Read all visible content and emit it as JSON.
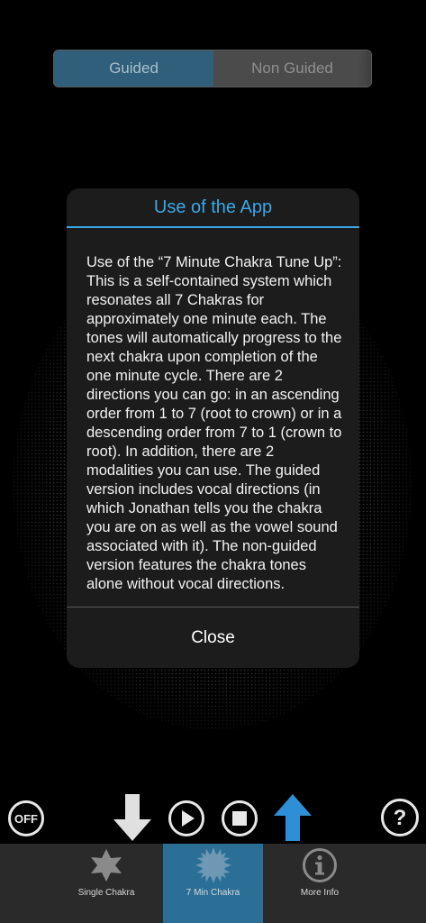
{
  "segmented": {
    "guided_label": "Guided",
    "non_guided_label": "Non Guided",
    "selected": "Guided"
  },
  "modal": {
    "title": "Use of the App",
    "body": "Use of the “7 Minute Chakra Tune Up”:  This is a self-contained system which resonates all 7 Chakras for approximately one minute each.  The tones will automatically progress to the next chakra upon completion of the one minute cycle. There are 2 directions you can go: in an ascending order from 1 to 7 (root to crown) or in a descending order from 7 to 1 (crown to root).  In addition, there are 2 modalities you can use. The guided version includes vocal directions (in which Jonathan tells you the chakra you are on as well as the vowel sound associated with it). The non-guided version features the chakra tones alone without vocal directions.",
    "close_label": "Close"
  },
  "controls": {
    "off_label": "OFF",
    "icons": [
      "off-icon",
      "down-arrow-icon",
      "play-icon",
      "stop-icon",
      "up-arrow-icon",
      "help-icon"
    ],
    "accent_color": "#2f8fd6"
  },
  "tabbar": {
    "tabs": [
      {
        "label": "Single Chakra",
        "icon": "star-icon"
      },
      {
        "label": "7 Min Chakra",
        "icon": "sunburst-icon",
        "active": true
      },
      {
        "label": "More Info",
        "icon": "info-icon"
      }
    ],
    "active_color": "#2c6f96"
  }
}
